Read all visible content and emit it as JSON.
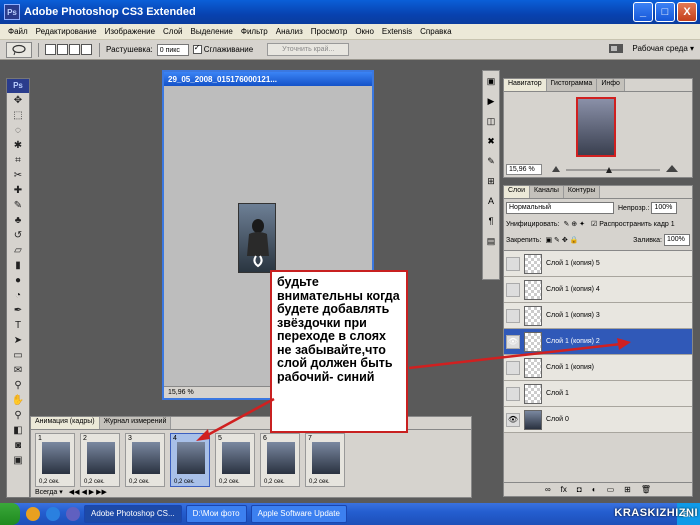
{
  "window": {
    "title": "Adobe Photoshop CS3 Extended",
    "app_icon": "Ps"
  },
  "window_buttons": [
    "_",
    "□",
    "X"
  ],
  "menu": [
    "Файл",
    "Редактирование",
    "Изображение",
    "Слой",
    "Выделение",
    "Фильтр",
    "Анализ",
    "Просмотр",
    "Окно",
    "Extensis",
    "Справка"
  ],
  "options": {
    "feather_label": "Растушевка:",
    "feather_value": "0 пикс",
    "antialias_label": "Сглаживание",
    "refine_edge_btn": "Уточнить край...",
    "workspace_label": "Рабочая среда ▾"
  },
  "toolbox": {
    "logo": "Ps"
  },
  "document": {
    "title": "29_05_2008_015176000121...",
    "zoom": "15,96 %"
  },
  "navigator": {
    "tabs": [
      "Навигатор",
      "Гистограмма",
      "Инфо"
    ],
    "zoom": "15,96 %"
  },
  "layers_panel": {
    "tabs": [
      "Слои",
      "Каналы",
      "Контуры"
    ],
    "blend_mode": "Нормальный",
    "opacity_label": "Непрозр.:",
    "opacity_value": "100%",
    "unify_label": "Унифицировать:",
    "propagate_label": "Распространить кадр 1",
    "lock_label": "Закрепить:",
    "fill_label": "Заливка:",
    "fill_value": "100%",
    "layers": [
      {
        "name": "Слой 1 (копия) 5",
        "visible": false,
        "active": false
      },
      {
        "name": "Слой 1 (копия) 4",
        "visible": false,
        "active": false
      },
      {
        "name": "Слой 1 (копия) 3",
        "visible": false,
        "active": false
      },
      {
        "name": "Слой 1 (копия) 2",
        "visible": true,
        "active": true
      },
      {
        "name": "Слой 1 (копия)",
        "visible": false,
        "active": false
      },
      {
        "name": "Слой 1",
        "visible": false,
        "active": false
      },
      {
        "name": "Слой 0",
        "visible": true,
        "active": false
      }
    ],
    "footer_icons": [
      "∞",
      "fx",
      "◘",
      "◐",
      "▭",
      "⊞",
      "🗑"
    ]
  },
  "animation_panel": {
    "tabs": [
      "Анимация (кадры)",
      "Журнал измерений"
    ],
    "frames": [
      {
        "number": "1",
        "delay": "0,2 сек.",
        "active": false
      },
      {
        "number": "2",
        "delay": "0,2 сек.",
        "active": false
      },
      {
        "number": "3",
        "delay": "0,2 сек.",
        "active": false
      },
      {
        "number": "4",
        "delay": "0,2 сек.",
        "active": true
      },
      {
        "number": "5",
        "delay": "0,2 сек.",
        "active": false
      },
      {
        "number": "6",
        "delay": "0,2 сек.",
        "active": false
      },
      {
        "number": "7",
        "delay": "0,2 сек.",
        "active": false
      }
    ],
    "loop_label": "Всегда ▾",
    "controls": "◀◀ ◀ ▶ ▶▶"
  },
  "callout": {
    "text": "будьте внимательны когда будете добавлять звёздочки при переходе в слоях не забывайте,что слой должен быть рабочий- синий"
  },
  "taskbar": {
    "tasks": [
      "Adobe Photoshop CS...",
      "D:\\Мои фото",
      "Apple Software Update"
    ],
    "lang": "EN"
  },
  "watermark": "KRASKIZHIZNI"
}
